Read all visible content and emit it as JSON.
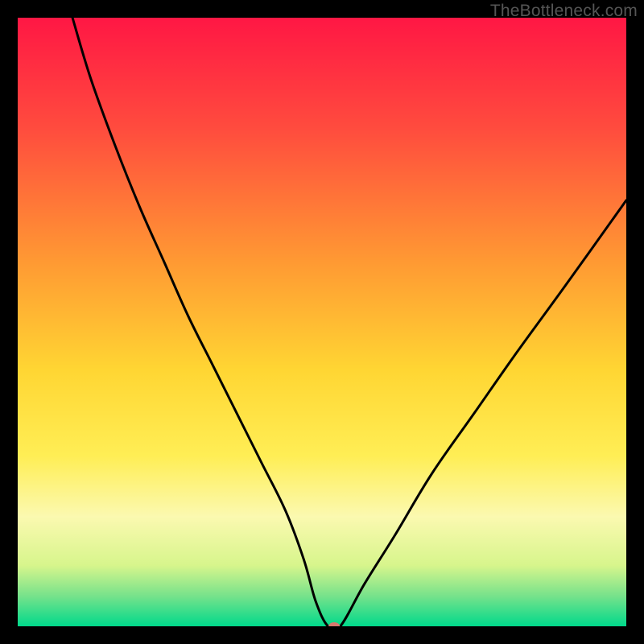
{
  "watermark": "TheBottleneck.com",
  "chart_data": {
    "type": "line",
    "title": "",
    "xlabel": "",
    "ylabel": "",
    "xlim": [
      0,
      100
    ],
    "ylim": [
      0,
      100
    ],
    "background_gradient": {
      "stops": [
        {
          "offset": 0,
          "color": "#ff1744"
        },
        {
          "offset": 18,
          "color": "#ff4b3e"
        },
        {
          "offset": 40,
          "color": "#ff9933"
        },
        {
          "offset": 58,
          "color": "#ffd633"
        },
        {
          "offset": 72,
          "color": "#ffee55"
        },
        {
          "offset": 82,
          "color": "#fbf9b0"
        },
        {
          "offset": 90,
          "color": "#d7f58c"
        },
        {
          "offset": 95,
          "color": "#77e28b"
        },
        {
          "offset": 100,
          "color": "#00d98b"
        }
      ]
    },
    "series": [
      {
        "name": "bottleneck-curve",
        "type": "line",
        "color": "#000000",
        "x": [
          9,
          12,
          16,
          20,
          24,
          28,
          32,
          36,
          40,
          44,
          47,
          49,
          51,
          53,
          57,
          62,
          68,
          75,
          82,
          90,
          100
        ],
        "y": [
          100,
          90,
          79,
          69,
          60,
          51,
          43,
          35,
          27,
          19,
          11,
          4,
          0,
          0,
          7,
          15,
          25,
          35,
          45,
          56,
          70
        ]
      }
    ],
    "marker": {
      "x": 52,
      "y": 0,
      "color": "#d6786e",
      "rx": 7,
      "ry": 5
    }
  }
}
